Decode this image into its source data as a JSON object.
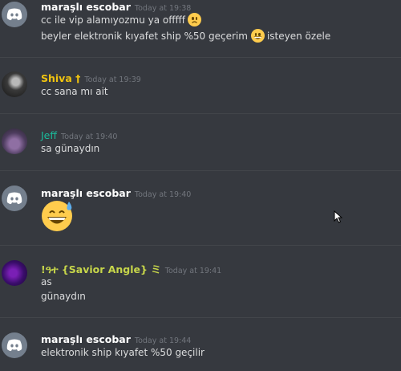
{
  "messages": [
    {
      "author": "maraşlı escobar",
      "timestamp": "Today at 19:38",
      "avatar": "discord-default-avatar",
      "lines": [
        {
          "text": "cc ile vip alamıyozmu ya offfff",
          "emoji": "frowning-face"
        },
        {
          "text_before": "beyler elektronik kıyafet ship %50 geçerim",
          "emoji": "grinning-face-big-eyes",
          "text_after": "isteyen özele"
        }
      ]
    },
    {
      "author": "Shiva †",
      "timestamp": "Today at 19:39",
      "author_color": "#f1c40f",
      "avatar": "user-photo-avatar",
      "lines": [
        {
          "text": "cc sana mı ait"
        }
      ]
    },
    {
      "author": "Jeff",
      "timestamp": "Today at 19:40",
      "author_color": "#1abc9c",
      "avatar": "user-photo-avatar",
      "lines": [
        {
          "text": "sa günaydın"
        }
      ]
    },
    {
      "author": "maraşlı escobar",
      "timestamp": "Today at 19:40",
      "avatar": "discord-default-avatar",
      "lines": [
        {
          "emoji": "grinning-face-with-sweat"
        }
      ]
    },
    {
      "author": "!ዓተ {Savior Angle} ミ",
      "timestamp": "Today at 19:41",
      "author_color": "#c7d64a",
      "avatar": "purple-photo-avatar",
      "lines": [
        {
          "text": "as"
        },
        {
          "text": "günaydın"
        }
      ]
    },
    {
      "author": "maraşlı escobar",
      "timestamp": "Today at 19:44",
      "avatar": "discord-default-avatar",
      "lines": [
        {
          "text": "elektronik ship kıyafet %50 geçilir"
        }
      ]
    }
  ],
  "colors": {
    "background": "#36393f",
    "text": "#dcddde",
    "timestamp": "#72767d",
    "divider": "#42454a"
  },
  "cursor": "mouse-pointer-icon"
}
